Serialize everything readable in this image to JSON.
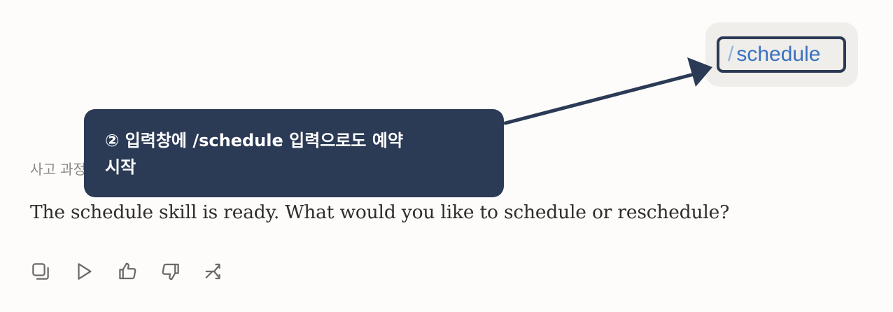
{
  "user_message": {
    "slash": "/",
    "command": "schedule"
  },
  "callout": {
    "line1": "② 입력창에 /schedule 입력으로도 예약",
    "line2": "시작"
  },
  "thinking_label": "사고 과정",
  "response": {
    "text": "The schedule skill is ready. What would you like to schedule or reschedule?"
  },
  "actions": [
    {
      "icon": "copy-icon"
    },
    {
      "icon": "play-icon"
    },
    {
      "icon": "thumbs-up-icon"
    },
    {
      "icon": "thumbs-down-icon"
    },
    {
      "icon": "retry-icon"
    }
  ],
  "colors": {
    "callout_bg": "#2b3a55",
    "command_text": "#3a72c0",
    "bubble_bg": "#f0eeea",
    "page_bg": "#fdfcfb"
  }
}
